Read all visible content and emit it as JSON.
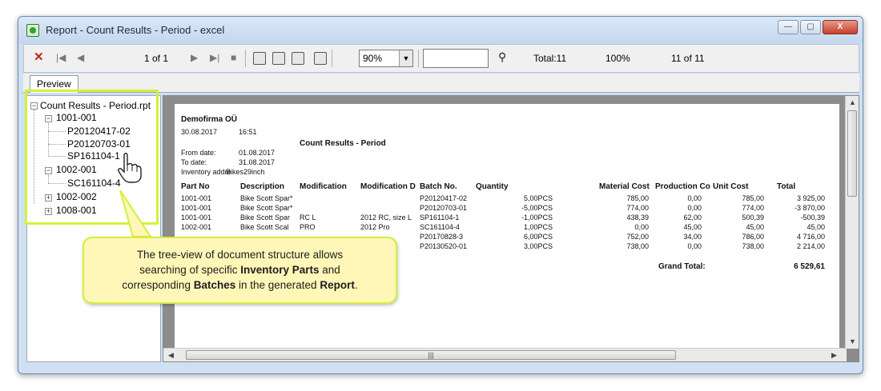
{
  "window": {
    "title": "Report - Count Results - Period - excel",
    "buttons": [
      "—",
      "▢",
      "X"
    ]
  },
  "toolbar": {
    "page_indicator": "1 of 1",
    "zoom": "90%",
    "total": "Total:11",
    "percent": "100%",
    "count": "11 of 11"
  },
  "tabs": [
    {
      "label": "Preview"
    }
  ],
  "tree": {
    "root": "Count Results - Period.rpt",
    "nodes": [
      {
        "label": "1001-001",
        "children": [
          "P20120417-02",
          "P20120703-01",
          "SP161104-1"
        ]
      },
      {
        "label": "1002-001",
        "children": [
          "SC161104-4"
        ]
      },
      {
        "label": "1002-002",
        "children": []
      },
      {
        "label": "1008-001",
        "children": []
      }
    ]
  },
  "report": {
    "company": "Demofirma OÜ",
    "date": "30.08.2017",
    "time": "16:51",
    "title": "Count Results - Period",
    "from_label": "From date:",
    "from_value": "01.08.2017",
    "to_label": "To date:",
    "to_value": "31.08.2017",
    "inventory_label": "Inventory addre",
    "inventory_value": "Bikes29inch",
    "headers": [
      "Part No",
      "Description",
      "Modification",
      "Modification D",
      "Batch No.",
      "Quantity",
      "Material Cost",
      "Production Co",
      "Unit Cost",
      "Total"
    ],
    "rows": [
      [
        "1001-001",
        "Bike Scott Spar*",
        "",
        "",
        "P20120417-02",
        "5,00PCS",
        "785,00",
        "0,00",
        "785,00",
        "3 925,00"
      ],
      [
        "1001-001",
        "Bike Scott Spar*",
        "",
        "",
        "P20120703-01",
        "-5,00PCS",
        "774,00",
        "0,00",
        "774,00",
        "-3 870,00"
      ],
      [
        "1001-001",
        "Bike Scott Spar",
        "RC L",
        "2012 RC, size L",
        "SP161104-1",
        "-1,00PCS",
        "438,39",
        "62,00",
        "500,39",
        "-500,39"
      ],
      [
        "1002-001",
        "Bike Scott Scal",
        "PRO",
        "2012 Pro",
        "SC161104-4",
        "1,00PCS",
        "0,00",
        "45,00",
        "45,00",
        "45,00"
      ],
      [
        "",
        "",
        "",
        "",
        "P20170828-3",
        "6,00PCS",
        "752,00",
        "34,00",
        "786,00",
        "4 716,00"
      ],
      [
        "",
        "",
        "",
        "",
        "P20130520-01",
        "3,00PCS",
        "738,00",
        "0,00",
        "738,00",
        "2 214,00"
      ]
    ],
    "grand_total_label": "Grand Total:",
    "grand_total_value": "6 529,61"
  },
  "callout": {
    "line1": "The tree-view of document structure allows",
    "line2a": "searching of specific ",
    "line2b": "Inventory Parts",
    "line2c": " and",
    "line3a": "corresponding ",
    "line3b": "Batches",
    "line3c": " in the generated ",
    "line3d": "Report",
    "line3e": "."
  },
  "colors": {
    "highlight": "#d6ef3a",
    "callout_bg": "#fff7b8",
    "close_red": "#c0281a"
  }
}
